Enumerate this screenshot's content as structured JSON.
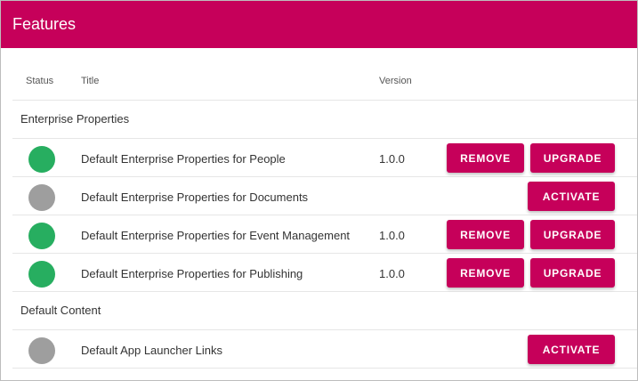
{
  "header": {
    "title": "Features"
  },
  "columns": {
    "status": "Status",
    "title": "Title",
    "version": "Version"
  },
  "colors": {
    "accent": "#c6005a",
    "status_active": "#27ae60",
    "status_inactive": "#9e9e9e"
  },
  "groups": [
    {
      "name": "Enterprise Properties",
      "features": [
        {
          "status": "active",
          "title": "Default Enterprise Properties for People",
          "version": "1.0.0",
          "actions": [
            "REMOVE",
            "UPGRADE"
          ]
        },
        {
          "status": "inactive",
          "title": "Default Enterprise Properties for Documents",
          "version": "",
          "actions": [
            "ACTIVATE"
          ]
        },
        {
          "status": "active",
          "title": "Default Enterprise Properties for Event Management",
          "version": "1.0.0",
          "actions": [
            "REMOVE",
            "UPGRADE"
          ]
        },
        {
          "status": "active",
          "title": "Default Enterprise Properties for Publishing",
          "version": "1.0.0",
          "actions": [
            "REMOVE",
            "UPGRADE"
          ]
        }
      ]
    },
    {
      "name": "Default Content",
      "features": [
        {
          "status": "inactive",
          "title": "Default App Launcher Links",
          "version": "",
          "actions": [
            "ACTIVATE"
          ]
        }
      ]
    }
  ]
}
